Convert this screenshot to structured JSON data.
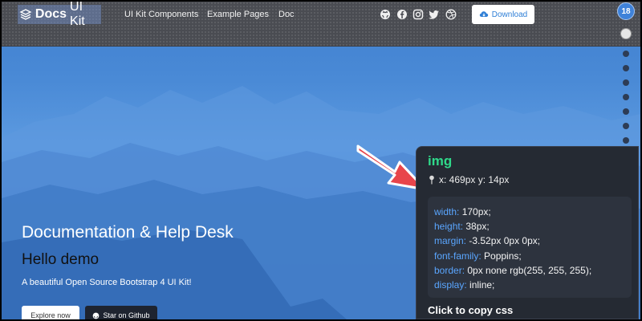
{
  "brand": {
    "name": "Docs",
    "suffix": "UI Kit"
  },
  "nav": {
    "links": [
      "UI Kit Components",
      "Example Pages",
      "Doc"
    ],
    "download_label": "Download"
  },
  "social_icons": [
    "github-icon",
    "facebook-icon",
    "instagram-icon",
    "twitter-icon",
    "dribbble-icon"
  ],
  "scroll_nav": {
    "badge": "18"
  },
  "hero": {
    "title": "Documentation & Help Desk",
    "subtitle": "Hello demo",
    "description": "A beautiful Open Source Bootstrap 4 UI Kit!",
    "explore_label": "Explore now",
    "github_label": "Star on Github"
  },
  "inspector": {
    "tag": "img",
    "position": "x: 469px  y: 14px",
    "properties": [
      {
        "key": "width:",
        "value": "170px;"
      },
      {
        "key": "height:",
        "value": "38px;"
      },
      {
        "key": "margin:",
        "value": "-3.52px 0px 0px;"
      },
      {
        "key": "font-family:",
        "value": "Poppins;"
      },
      {
        "key": "border:",
        "value": "0px none rgb(255, 255, 255);"
      },
      {
        "key": "display:",
        "value": "inline;"
      }
    ],
    "copy_label": "Click to copy css"
  },
  "colors": {
    "accent": "#2f7fd6",
    "inspector_tag": "#2fd88a",
    "inspector_key": "#5aa6ff",
    "arrow": "#e8454b"
  }
}
